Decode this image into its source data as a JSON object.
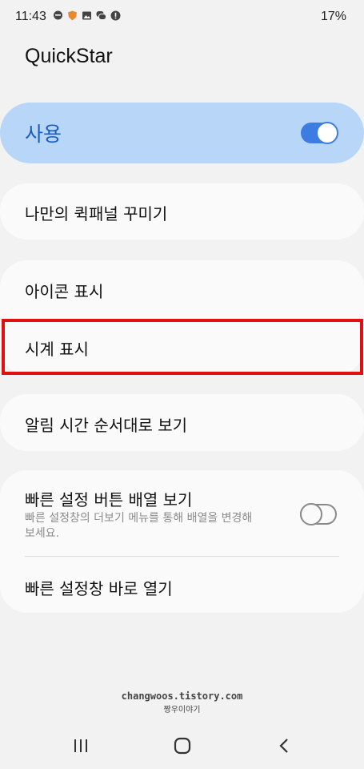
{
  "status_bar": {
    "time": "11:43",
    "battery": "17%",
    "icons": [
      "chat-bubble-icon",
      "shield-icon",
      "image-icon",
      "messages-icon",
      "alert-icon"
    ]
  },
  "app_title": "QuickStar",
  "master_switch": {
    "label": "사용",
    "state": "on"
  },
  "menu": {
    "customize_panel": "나만의 퀵패널 꾸미기",
    "show_icons": "아이콘 표시",
    "show_clock": "시계 표시",
    "sort_notifications_by_time": "알림 시간 순서대로 보기",
    "quick_settings_grid": {
      "label": "빠른 설정 버튼 배열 보기",
      "description": "빠른 설정창의 더보기 메뉴를 통해 배열을 변경해 보세요.",
      "state": "off"
    },
    "open_quick_settings_directly": "빠른 설정창 바로 열기"
  },
  "watermark": {
    "line1": "changwoos.tistory.com",
    "line2": "짱우이야기"
  },
  "colors": {
    "accent": "#3d7ce0",
    "master_bg": "#b7d6f8",
    "highlight": "#e01010"
  }
}
